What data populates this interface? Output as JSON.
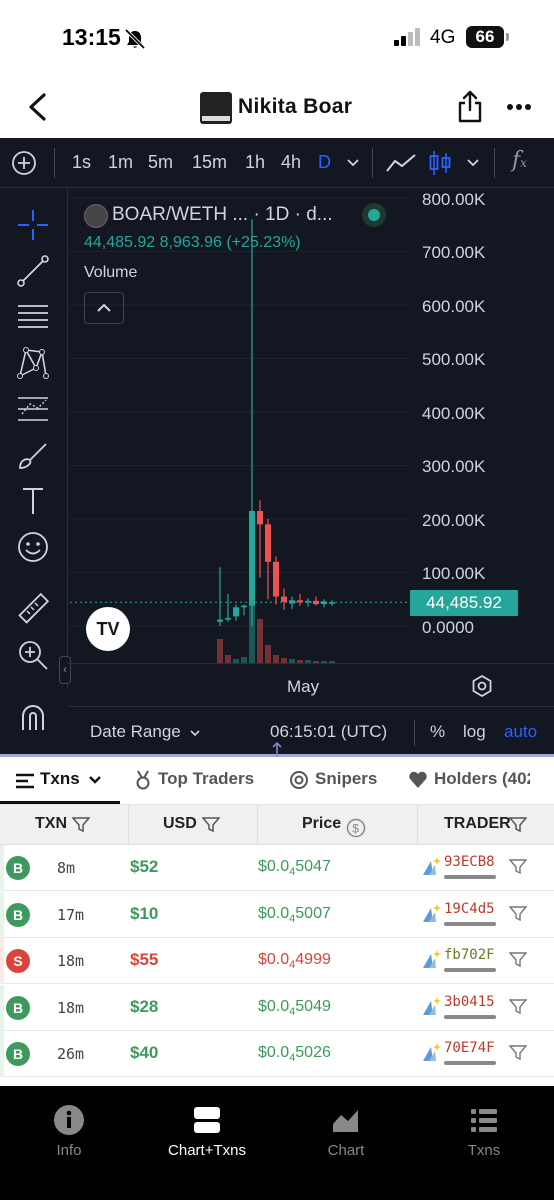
{
  "status": {
    "time": "13:15",
    "network": "4G",
    "battery": "66"
  },
  "header": {
    "title": "Nikita Boar"
  },
  "chart_toolbar": {
    "timeframes": [
      "1s",
      "1m",
      "5m",
      "15m",
      "1h",
      "4h",
      "D"
    ],
    "active_timeframe": "D"
  },
  "chart": {
    "symbol": "BOAR/WETH ... · 1D · d...",
    "ohlc": "44,485.92  8,963.96 (+25.23%)",
    "volume_label": "Volume",
    "current_price": "44,485.92",
    "x_label": "May",
    "date_range": "Date Range",
    "time_utc": "06:15:01 (UTC)",
    "scale_pct": "%",
    "scale_log": "log",
    "scale_auto": "auto"
  },
  "chart_data": {
    "type": "candlestick",
    "y_ticks": [
      "800.00K",
      "700.00K",
      "600.00K",
      "500.00K",
      "400.00K",
      "300.00K",
      "200.00K",
      "100.00K",
      "0.0000"
    ],
    "ylim": [
      0,
      800000
    ],
    "x_tick": "May",
    "last_price": 44485.92
  },
  "tabs": {
    "txns": "Txns",
    "top_traders": "Top Traders",
    "snipers": "Snipers",
    "holders": "Holders (402"
  },
  "table": {
    "headers": {
      "txn": "TXN",
      "usd": "USD",
      "price": "Price",
      "trader": "TRADER"
    },
    "rows": [
      {
        "type": "B",
        "age": "8m",
        "usd": "$52",
        "price_a": "$0.0",
        "price_sub": "4",
        "price_b": "5047",
        "trader": "93ECB8"
      },
      {
        "type": "B",
        "age": "17m",
        "usd": "$10",
        "price_a": "$0.0",
        "price_sub": "4",
        "price_b": "5007",
        "trader": "19C4d5"
      },
      {
        "type": "S",
        "age": "18m",
        "usd": "$55",
        "price_a": "$0.0",
        "price_sub": "4",
        "price_b": "4999",
        "trader": "fb702F"
      },
      {
        "type": "B",
        "age": "18m",
        "usd": "$28",
        "price_a": "$0.0",
        "price_sub": "4",
        "price_b": "5049",
        "trader": "3b0415"
      },
      {
        "type": "B",
        "age": "26m",
        "usd": "$40",
        "price_a": "$0.0",
        "price_sub": "4",
        "price_b": "5026",
        "trader": "70E74F"
      }
    ]
  },
  "bottom_nav": {
    "info": "Info",
    "chart_txns": "Chart+Txns",
    "chart": "Chart",
    "txns": "Txns"
  },
  "colors": {
    "buy": "#3d9a5c",
    "sell": "#d9453c",
    "accent": "#2962ff",
    "bg_chart": "#131722"
  }
}
